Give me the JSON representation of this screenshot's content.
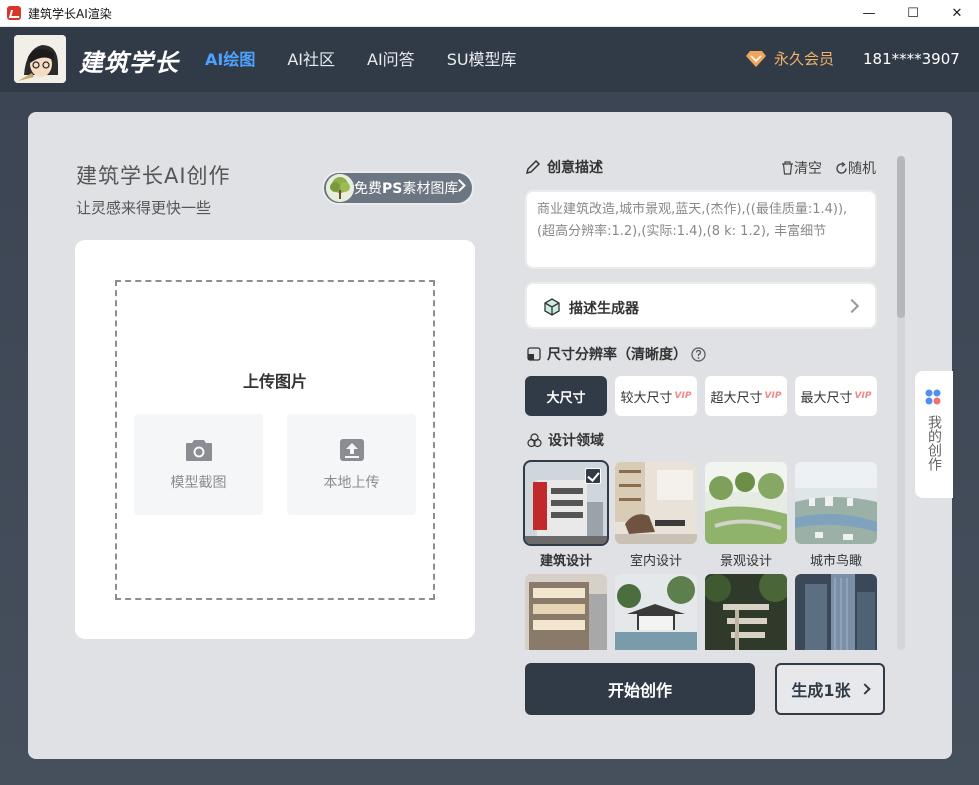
{
  "window": {
    "title": "建筑学长AI渲染",
    "minimize": "—",
    "maximize": "☐",
    "close": "✕"
  },
  "header": {
    "brand": "建筑学长",
    "nav": [
      {
        "label": "AI绘图",
        "active": true
      },
      {
        "label": "AI社区",
        "active": false
      },
      {
        "label": "AI问答",
        "active": false
      },
      {
        "label": "SU模型库",
        "active": false
      }
    ],
    "membership": "永久会员",
    "phone": "181****3907",
    "colors": {
      "bg": "#313b48",
      "active": "#4ea2ff",
      "vip": "#f1b36c"
    }
  },
  "left": {
    "title": "建筑学长AI创作",
    "subtitle": "让灵感来得更快一些",
    "ps_button": {
      "prefix": "免费",
      "bold": "PS",
      "suffix": "素材图库"
    },
    "upload": {
      "title": "上传图片",
      "model_capture": "模型截图",
      "local_upload": "本地上传"
    }
  },
  "right": {
    "prompt_section": "创意描述",
    "clear": "清空",
    "random": "随机",
    "prompt_text": "商业建筑改造,城市景观,蓝天,(杰作),((最佳质量:1.4)),(超高分辨率:1.2),(实际:1.4),(8 k: 1.2), 丰富细节",
    "generator": "描述生成器",
    "size_section": "尺寸分辨率（清晰度）",
    "sizes": [
      {
        "label": "大尺寸",
        "vip": "",
        "active": true
      },
      {
        "label": "较大尺寸",
        "vip": "VIP",
        "active": false
      },
      {
        "label": "超大尺寸",
        "vip": "VIP",
        "active": false
      },
      {
        "label": "最大尺寸",
        "vip": "VIP",
        "active": false
      }
    ],
    "domain_section": "设计领域",
    "domains": [
      {
        "label": "建筑设计",
        "selected": true
      },
      {
        "label": "室内设计",
        "selected": false
      },
      {
        "label": "景观设计",
        "selected": false
      },
      {
        "label": "城市鸟瞰",
        "selected": false
      }
    ],
    "start": "开始创作",
    "count": "生成1张"
  },
  "side_tab": {
    "label": "我的创作"
  }
}
